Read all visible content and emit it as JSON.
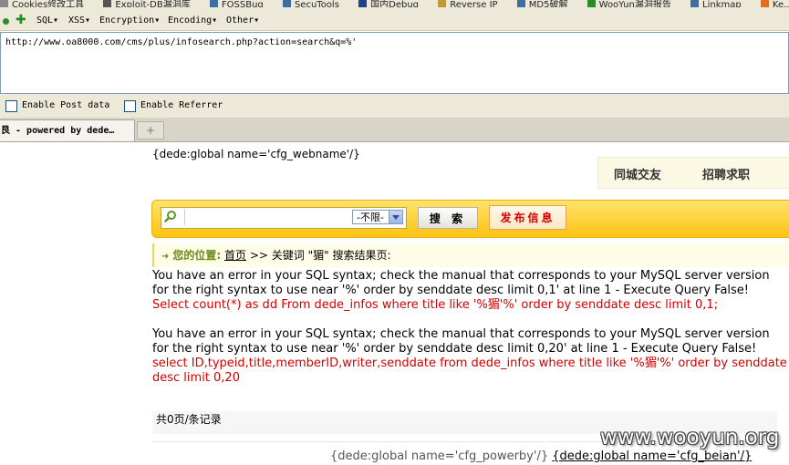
{
  "bookmarks": [
    {
      "label": "Cookies修改工具"
    },
    {
      "label": "Exploit-DB漏洞库"
    },
    {
      "label": "FOSSBug"
    },
    {
      "label": "SecuTools"
    },
    {
      "label": "国内Debug"
    },
    {
      "label": "Reverse IP"
    },
    {
      "label": "MD5破解"
    },
    {
      "label": "WooYun漏洞报告"
    },
    {
      "label": "Linkmap"
    },
    {
      "label": "Ke..."
    }
  ],
  "hackbar": {
    "menus": [
      "SQL▾",
      "XSS▾",
      "Encryption▾",
      "Encoding▾",
      "Other▾"
    ],
    "url": "http://www.oa8000.com/cms/plus/infosearch.php?action=search&q=%'",
    "enable_post": "Enable Post data",
    "enable_referrer": "Enable Referrer"
  },
  "tabs": {
    "active_label": "艮 - powered by dede…",
    "new_tab": "+"
  },
  "page": {
    "webname_tag": "{dede:global name='cfg_webname'/}",
    "nav": [
      "同城交友",
      "招聘求职"
    ],
    "search": {
      "select_value": "-不限-",
      "search_button": "搜 索",
      "post_button": "发布信息"
    },
    "breadcrumb": {
      "location_label": "您的位置:",
      "home": "首页",
      "rest": ">> 关键词 \"猸\" 搜索结果页:"
    },
    "errors": [
      {
        "text": "You have an error in your SQL syntax; check the manual that corresponds to your MySQL server version for the right syntax to use near '%' order by senddate desc limit 0,1' at line 1 - Execute Query False!",
        "query": "Select count(*) as dd From dede_infos where title like '%猸'%' order by senddate desc limit 0,1;"
      },
      {
        "text": "You have an error in your SQL syntax; check the manual that corresponds to your MySQL server version for the right syntax to use near '%' order by senddate desc limit 0,20' at line 1 - Execute Query False!",
        "query": "select ID,typeid,title,memberID,writer,senddate from dede_infos where title like '%猸'%' order by senddate desc limit 0,20"
      }
    ],
    "records": "共0页/条记录",
    "footer_powerby": "{dede:global name='cfg_powerby'/}",
    "footer_beian": "{dede:global name='cfg_beian'/}"
  },
  "watermark": "www.wooyun.org",
  "colors": {
    "error_query": "#d40000",
    "search_bar": "#fcc312",
    "post_button_text": "#d30000"
  }
}
